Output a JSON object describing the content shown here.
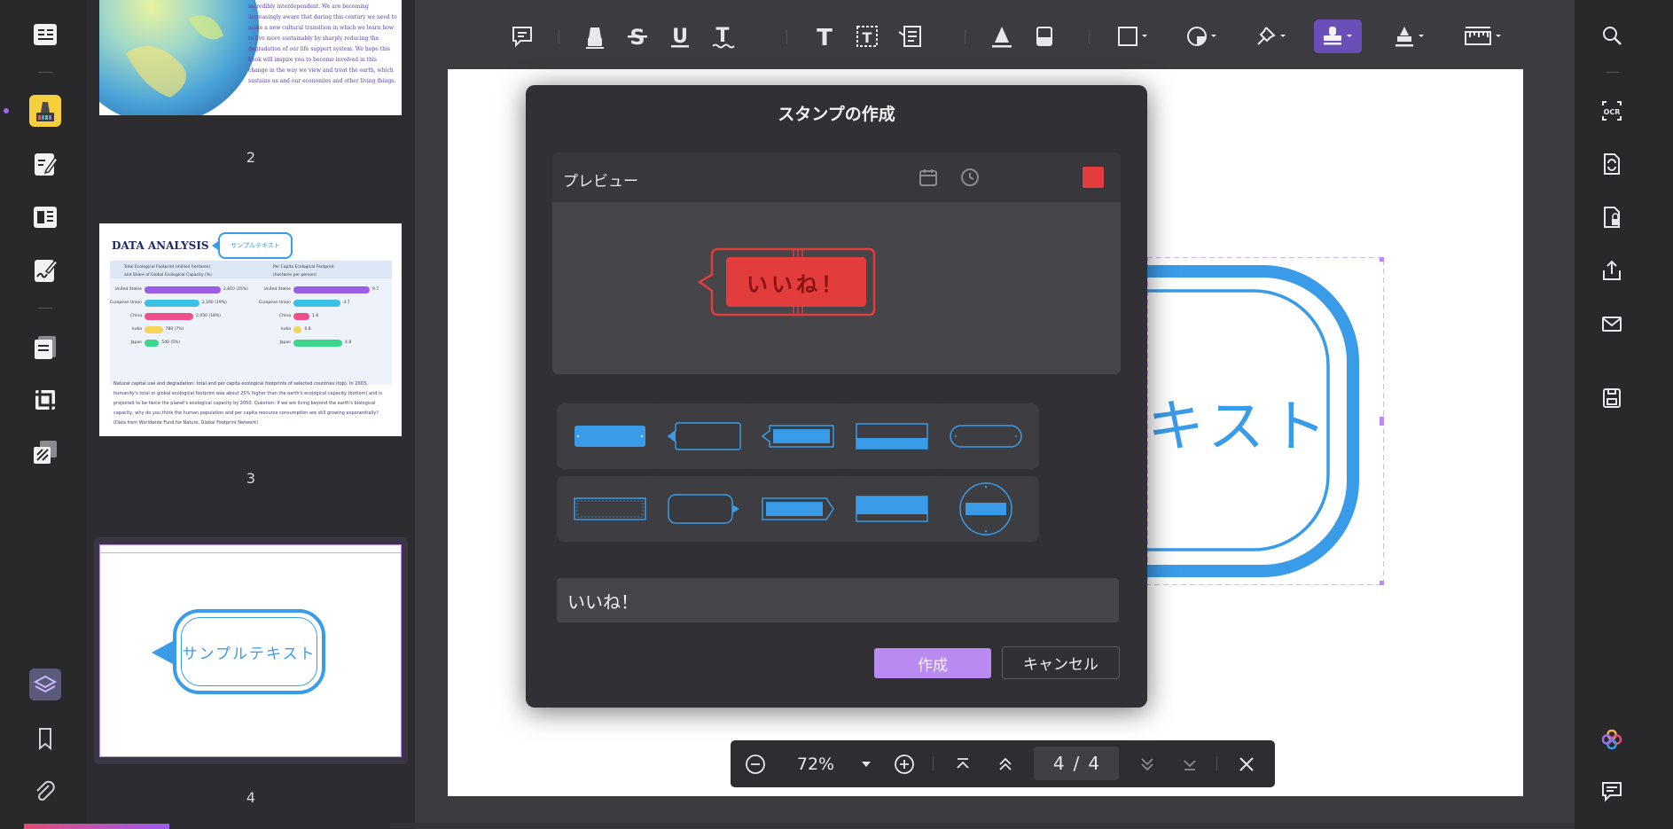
{
  "dialog": {
    "title": "スタンプの作成",
    "preview_label": "プレビュー",
    "stamp_text": "いいね！",
    "input_value": "いいね！",
    "create_label": "作成",
    "cancel_label": "キャンセル",
    "stamp_color": "#e23c3c"
  },
  "thumbnails": {
    "page2_label": "2",
    "page3_label": "3",
    "page4_label": "4",
    "page2_text": "incredibly interdependent. We are becoming increasingly aware that during this century we need to make a new cultural transition in which we learn how to live more sustainably by sharply reducing the degradation of our life support system. We hope this book will inspire you to become involved in this change in the way we view and treat the earth, which sustains us and our economies and other living things.",
    "page3": {
      "title": "DATA ANALYSIS",
      "bubble": "サンプルテキスト",
      "legend_left_1": "Total Ecological Footprint (million hectares)",
      "legend_left_2": "and Share of Global Ecological Capacity (%)",
      "legend_right_1": "Per Capita Ecological Footprint",
      "legend_right_2": "(hectares per person)",
      "left_rows": [
        {
          "name": "United States",
          "value": "2,810 (25%)",
          "color": "#9b5de5",
          "pct": 1.0
        },
        {
          "name": "European Union",
          "value": "2,160 (19%)",
          "color": "#3cc0e6",
          "pct": 0.72
        },
        {
          "name": "China",
          "value": "2,050 (18%)",
          "color": "#f0508a",
          "pct": 0.64
        },
        {
          "name": "India",
          "value": "780 (7%)",
          "color": "#f5d55a",
          "pct": 0.24
        },
        {
          "name": "Japan",
          "value": "540 (5%)",
          "color": "#3cd68c",
          "pct": 0.19
        }
      ],
      "right_rows": [
        {
          "name": "United States",
          "value": "9.7",
          "color": "#9b5de5",
          "pct": 1.0
        },
        {
          "name": "European Union",
          "value": "4.7",
          "color": "#3cc0e6",
          "pct": 0.62
        },
        {
          "name": "China",
          "value": "1.6",
          "color": "#f0508a",
          "pct": 0.21
        },
        {
          "name": "India",
          "value": "0.8",
          "color": "#f5d55a",
          "pct": 0.11
        },
        {
          "name": "Japan",
          "value": "4.8",
          "color": "#3cd68c",
          "pct": 0.64
        }
      ],
      "paragraph": "Natural capital use and degradation: total and per capita ecological footprints of selected countries (top). In 2003, humanity's total or global ecological footprint was about 25% higher than the earth's ecological capacity (bottom) and is projected to be twice the planet's ecological capacity by 2050. Question: If we are living beyond the earth's biological capacity, why do you think the human population and per capita resource consumption are still growing exponentially? (Data from Worldwide Fund for Nature, Global Footprint Network)"
    },
    "page4_text": "サンプルテキスト"
  },
  "canvas": {
    "stamp_partial_text": "キスト",
    "accent": "#3a9be8"
  },
  "navbar": {
    "zoom": "72%",
    "current_page": "4",
    "page_sep": "/",
    "total_pages": "4"
  },
  "colors": {
    "accent_purple": "#9b6bf2",
    "stamp_blue": "#3a9be8"
  }
}
